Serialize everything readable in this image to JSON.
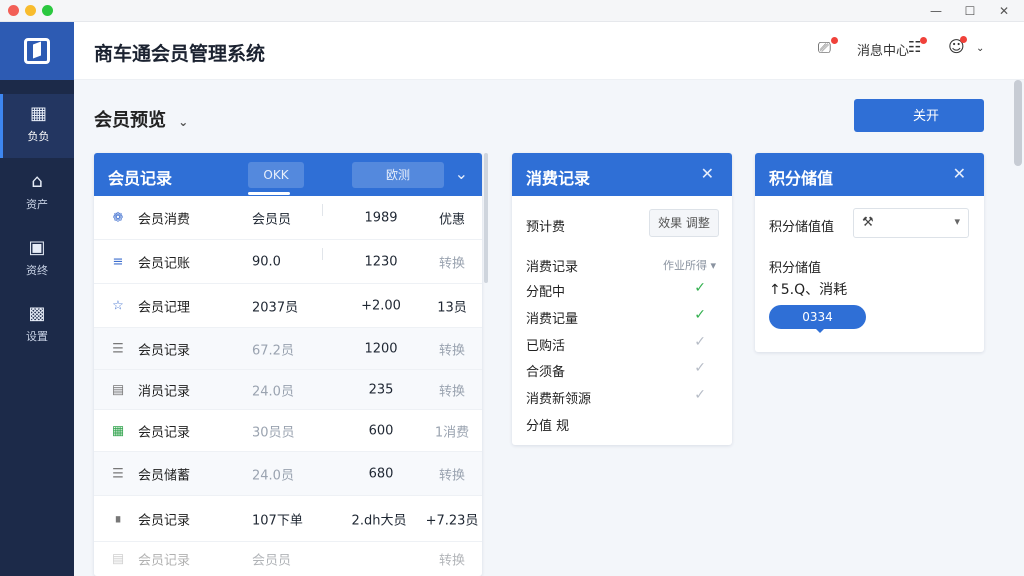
{
  "window": {
    "minimize": "—",
    "restore": "☐",
    "close": "✕"
  },
  "sidebar": {
    "items": [
      {
        "label": "负负",
        "icon": "grid-icon"
      },
      {
        "label": "资产",
        "icon": "shop-icon"
      },
      {
        "label": "资终",
        "icon": "robot-icon"
      },
      {
        "label": "设置",
        "icon": "chart-icon"
      }
    ]
  },
  "header": {
    "title": "商车通会员管理系统",
    "notify_label": "消息中心"
  },
  "page": {
    "title": "会员预览",
    "open_button": "关开"
  },
  "member_card": {
    "title": "会员记录",
    "tab1": "OKK",
    "tab2": "欧测",
    "rows": [
      {
        "icon": "gear-icon",
        "name": "会员消费",
        "a": "会员员",
        "b": "1989",
        "c": "优惠"
      },
      {
        "icon": "list-icon",
        "name": "会员记账",
        "a": "90.0",
        "b": "1230",
        "c": "转换"
      },
      {
        "icon": "star-icon",
        "name": "会员记理",
        "a": "2037员",
        "b": "+2.00",
        "c": "13员"
      },
      {
        "icon": "menu-icon",
        "name": "会员记录",
        "a": "67.2员",
        "b": "1200",
        "c": "转换"
      },
      {
        "icon": "doc-icon",
        "name": "消员记录",
        "a": "24.0员",
        "b": "235",
        "c": "转换"
      },
      {
        "icon": "apps-icon",
        "name": "会员记录",
        "a": "30员员",
        "b": "600",
        "c": "1消费"
      },
      {
        "icon": "menu-icon",
        "name": "会员储蓄",
        "a": "24.0员",
        "b": "680",
        "c": "转换"
      },
      {
        "icon": "tag-icon",
        "name": "会员记录",
        "a": "107下单",
        "b": "2.dh大员",
        "c": "+7.23员"
      },
      {
        "icon": "doc-icon",
        "name": "会员记录",
        "a": "会员员",
        "b": "",
        "c": "转换"
      }
    ]
  },
  "consume_card": {
    "title": "消费记录",
    "filter_label": "预计费",
    "filter_value": "效果 调整",
    "items": [
      {
        "label": "消费记录",
        "select": "作业所得 ▾"
      },
      {
        "label": "分配中",
        "check": "on"
      },
      {
        "label": "消费记量",
        "check": "on"
      },
      {
        "label": "已购活",
        "check": "off"
      },
      {
        "label": "合须备",
        "check": "off"
      },
      {
        "label": "消费新领源",
        "check": "off"
      },
      {
        "label": "分值 规",
        "check": "none"
      }
    ]
  },
  "points_card": {
    "title": "积分储值",
    "field_label": "积分储值值",
    "sub_title": "积分储值",
    "value_text": "↑5.Q、消耗",
    "pill": "0334"
  },
  "colors": {
    "accent": "#2f6fd6",
    "sidebar": "#1c2a49",
    "logo": "#2d5bb3",
    "success": "#33b04f"
  }
}
